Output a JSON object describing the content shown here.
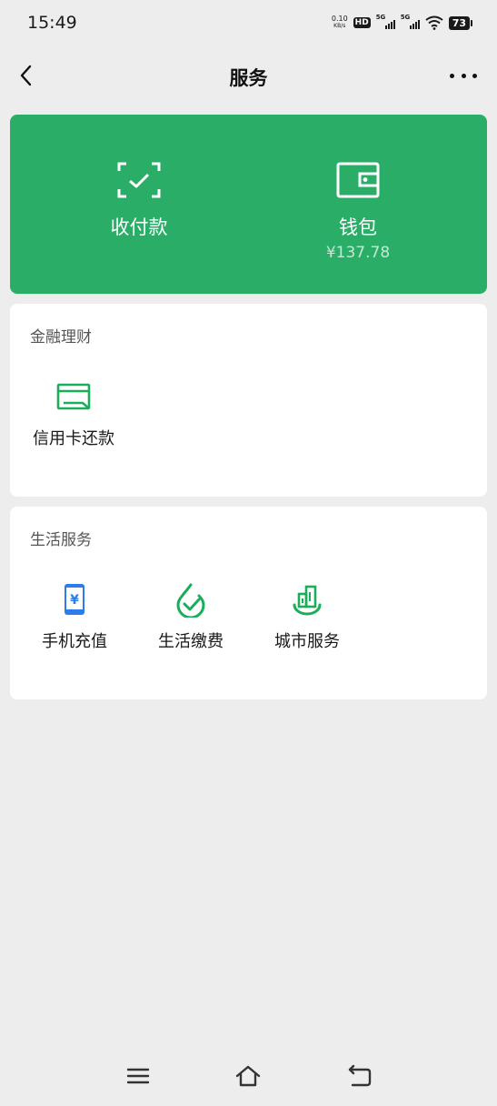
{
  "status_bar": {
    "time": "15:49",
    "net_speed_value": "0.10",
    "net_speed_unit": "KB/s",
    "hd_label": "HD",
    "sim1_label": "5G",
    "sim2_label": "5G",
    "battery": "73"
  },
  "nav": {
    "title": "服务",
    "back_icon": "chevron-left-icon",
    "more_icon": "more-dots-icon"
  },
  "top_card": {
    "background": "#2aae67",
    "pay": {
      "label": "收付款",
      "icon": "scan-check-icon"
    },
    "wallet": {
      "label": "钱包",
      "balance": "¥137.78",
      "icon": "wallet-icon"
    }
  },
  "finance_section": {
    "title": "金融理财",
    "items": [
      {
        "label": "信用卡还款",
        "icon": "credit-card-icon",
        "color": "#1aad5a"
      }
    ]
  },
  "life_section": {
    "title": "生活服务",
    "items": [
      {
        "label": "手机充值",
        "icon": "mobile-topup-icon",
        "color": "#2b7de9"
      },
      {
        "label": "生活缴费",
        "icon": "utility-payment-icon",
        "color": "#1aad5a"
      },
      {
        "label": "城市服务",
        "icon": "city-service-icon",
        "color": "#1aad5a"
      }
    ]
  },
  "bottom_nav": {
    "menu_icon": "menu-icon",
    "home_icon": "home-icon",
    "back_icon": "back-arrow-icon"
  }
}
